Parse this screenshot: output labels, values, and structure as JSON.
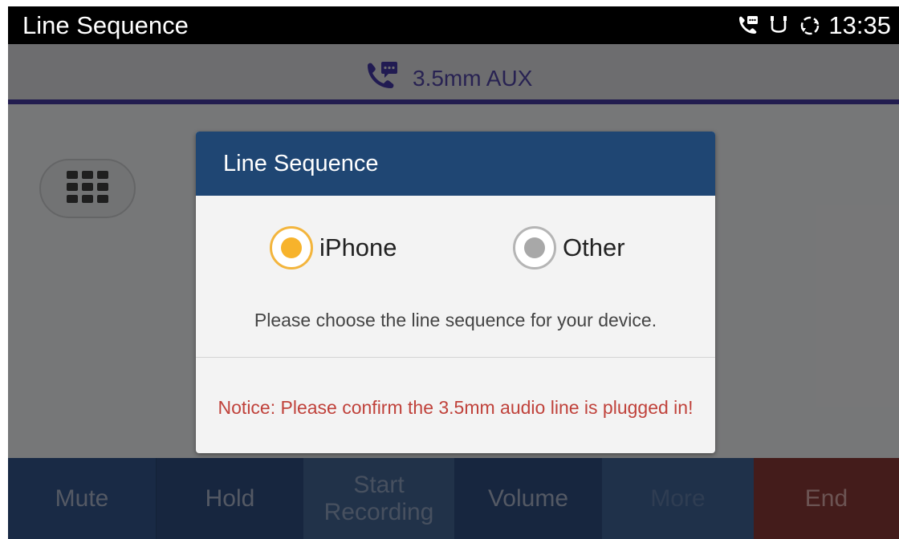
{
  "statusbar": {
    "title": "Line Sequence",
    "time": "13:35",
    "icons": [
      "call-message-icon",
      "headset-jack-icon",
      "sync-icon"
    ]
  },
  "call": {
    "line_label": "3.5mm AUX",
    "line_icon": "call-message-icon"
  },
  "keypad": {
    "icon": "dialpad-icon"
  },
  "bottombar": {
    "mute": "Mute",
    "hold": "Hold",
    "record_line1": "Start",
    "record_line2": "Recording",
    "volume": "Volume",
    "more": "More",
    "end": "End"
  },
  "dialog": {
    "title": "Line Sequence",
    "options": [
      {
        "label": "iPhone",
        "selected": true
      },
      {
        "label": "Other",
        "selected": false
      }
    ],
    "prompt": "Please choose the line sequence for your device.",
    "notice": "Notice: Please confirm the 3.5mm audio line is plugged in!"
  },
  "colors": {
    "dialog_header": "#1f4673",
    "radio_selected": "#f7b32b",
    "notice": "#c0423b",
    "line_accent": "#3f3690",
    "end_button": "#7c3432"
  }
}
